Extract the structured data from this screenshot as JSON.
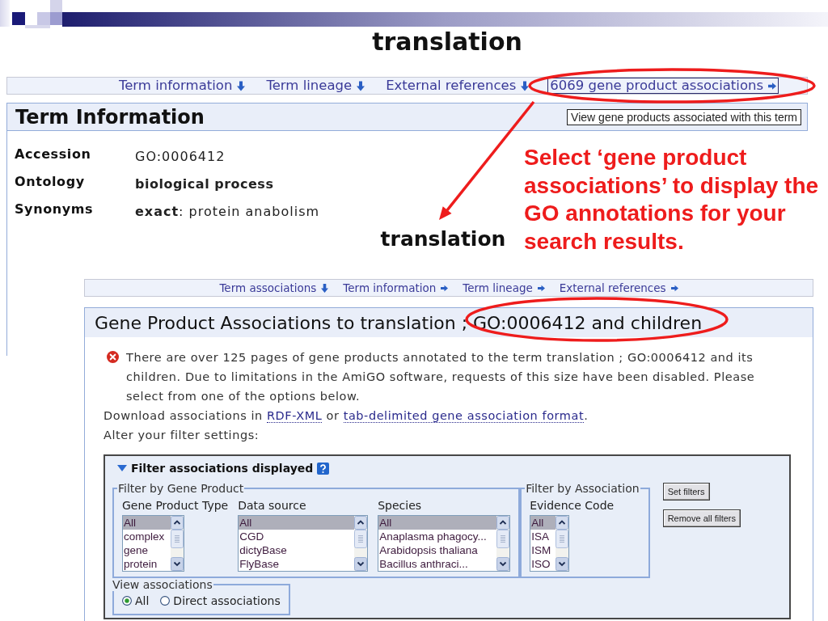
{
  "term_page": {
    "title": "translation",
    "nav_links": [
      {
        "label": "Term information",
        "kind": "down",
        "focused": false
      },
      {
        "label": "Term lineage",
        "kind": "down",
        "focused": false
      },
      {
        "label": "External references",
        "kind": "down",
        "focused": false
      },
      {
        "label": "6069 gene product associations",
        "kind": "right",
        "focused": true
      }
    ],
    "panel": {
      "title": "Term Information",
      "tooltip": "View gene products associated with this term",
      "fields": [
        {
          "label": "Accession",
          "value": "GO:0006412",
          "bold": false
        },
        {
          "label": "Ontology",
          "value": "biological process",
          "bold": true
        },
        {
          "label": "Synonyms",
          "value": "**exact**: protein anabolism",
          "bold": false
        }
      ]
    }
  },
  "callout": "Select ‘gene product associations’ to display the GO annotations for your search results.",
  "associations_page": {
    "title": "translation",
    "nav_links": [
      {
        "label": "Term associations",
        "kind": "down"
      },
      {
        "label": "Term information",
        "kind": "right"
      },
      {
        "label": "Term lineage",
        "kind": "right"
      },
      {
        "label": "External references",
        "kind": "right"
      }
    ],
    "panel": {
      "title": "Gene Product Associations to translation ; GO:0006412 and children",
      "error": "There are over 125 pages of gene products annotated to the term translation ; GO:0006412 and its children. Due to limitations in the AmiGO software, requests of this size have been disabled. Please select from one of the options below.",
      "download": [
        {
          "kind": "text",
          "text": "Download associations in "
        },
        {
          "kind": "link",
          "text": "RDF-XML"
        },
        {
          "kind": "text",
          "text": " or "
        },
        {
          "kind": "link",
          "text": "tab-delimited gene association format"
        },
        {
          "kind": "text",
          "text": "."
        }
      ],
      "prompt": "Alter your filter settings:",
      "filter": {
        "title": "Filter associations displayed",
        "expanded": true,
        "groups": [
          {
            "legend": "Filter by Gene Product",
            "lists": [
              {
                "label": "Gene Product Type",
                "options": [
                  {
                    "text": "All",
                    "selected": true
                  },
                  {
                    "text": "complex",
                    "selected": false
                  },
                  {
                    "text": "gene",
                    "selected": false
                  },
                  {
                    "text": "protein",
                    "selected": false
                  }
                ]
              },
              {
                "label": "Data source",
                "options": [
                  {
                    "text": "All",
                    "selected": true
                  },
                  {
                    "text": "CGD",
                    "selected": false
                  },
                  {
                    "text": "dictyBase",
                    "selected": false
                  },
                  {
                    "text": "FlyBase",
                    "selected": false
                  }
                ]
              },
              {
                "label": "Species",
                "options": [
                  {
                    "text": "All",
                    "selected": true
                  },
                  {
                    "text": "Anaplasma phagocy...",
                    "selected": false
                  },
                  {
                    "text": "Arabidopsis thaliana",
                    "selected": false
                  },
                  {
                    "text": "Bacillus anthraci...",
                    "selected": false
                  }
                ]
              }
            ]
          },
          {
            "legend": "Filter by Association",
            "lists": [
              {
                "label": "Evidence Code",
                "options": [
                  {
                    "text": "All",
                    "selected": true
                  },
                  {
                    "text": "ISA",
                    "selected": false
                  },
                  {
                    "text": "ISM",
                    "selected": false
                  },
                  {
                    "text": "ISO",
                    "selected": false
                  }
                ]
              }
            ]
          }
        ],
        "buttons": [
          "Set filters",
          "Remove all filters"
        ],
        "view": {
          "legend": "View associations",
          "options": [
            {
              "label": "All",
              "selected": true
            },
            {
              "label": "Direct associations",
              "selected": false
            }
          ]
        }
      }
    }
  }
}
